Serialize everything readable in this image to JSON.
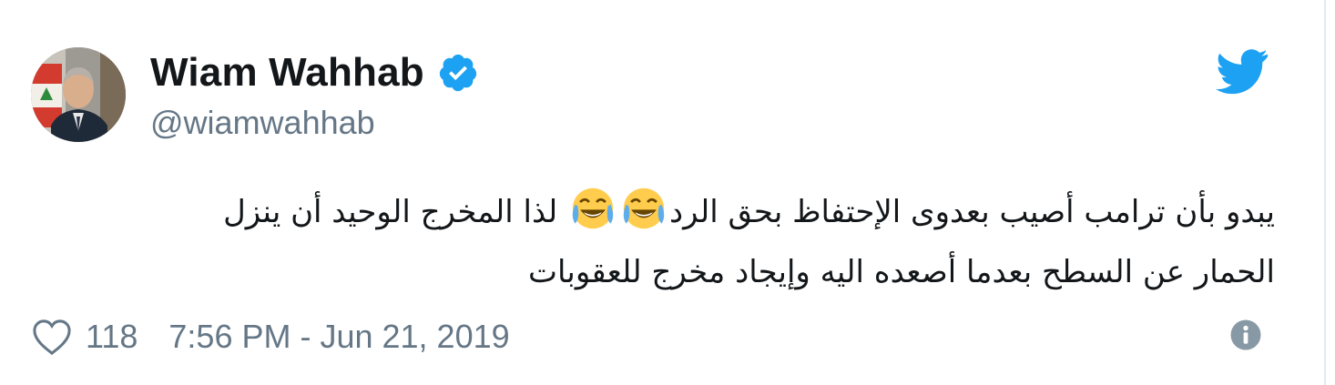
{
  "author": {
    "display_name": "Wiam Wahhab",
    "handle": "@wiamwahhab",
    "verified": true,
    "avatar_icon": "profile-photo"
  },
  "brand": {
    "icon": "twitter-bird-icon",
    "color": "#1da1f2"
  },
  "tweet": {
    "line1": "يبدو بأن ترامب أصيب بعدوى الإحتفاظ بحق الرد",
    "emojis": [
      "😂",
      "😂"
    ],
    "line1_end": "لذا المخرج الوحيد أن ينزل",
    "line2": "الحمار عن السطح بعدما أصعده اليه وإيجاد مخرج للعقوبات"
  },
  "footer": {
    "like_icon": "heart-icon",
    "like_count": "118",
    "timestamp": "7:56 PM - Jun 21, 2019",
    "info_icon": "info-icon"
  },
  "colors": {
    "text": "#14171a",
    "secondary": "#657786",
    "verified": "#1da1f2",
    "emoji": "#ffcc4d"
  }
}
